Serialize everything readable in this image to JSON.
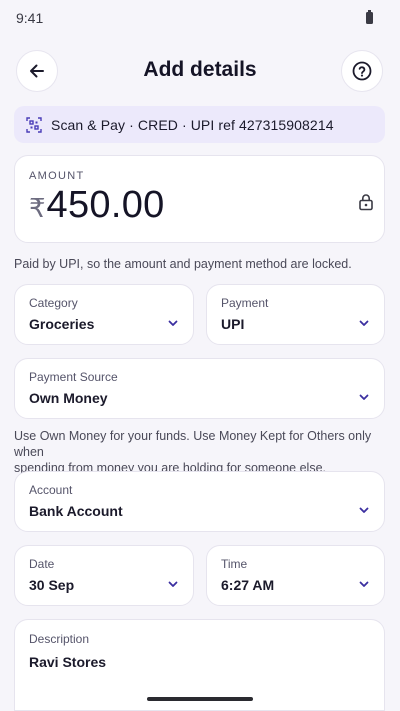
{
  "status_bar": {
    "time": "9:41"
  },
  "header": {
    "title": "Add details"
  },
  "banner": {
    "text": "Scan & Pay · CRED · UPI ref 427315908214"
  },
  "amount": {
    "label": "AMOUNT",
    "currency": "₹",
    "value": "450.00"
  },
  "locked_note": "Paid by UPI, so the amount and payment method are locked.",
  "category": {
    "label": "Category",
    "value": "Groceries"
  },
  "payment": {
    "label": "Payment",
    "value": "UPI"
  },
  "payment_source": {
    "label": "Payment Source",
    "value": "Own Money"
  },
  "source_note": {
    "line1": "Use Own Money for your funds. Use Money Kept for Others only when",
    "line2": "spending from money you are holding for someone else."
  },
  "account": {
    "label": "Account",
    "value": "Bank Account"
  },
  "date": {
    "label": "Date",
    "value": "30 Sep"
  },
  "time": {
    "label": "Time",
    "value": "6:27 AM"
  },
  "description": {
    "label": "Description",
    "value": "Ravi Stores"
  },
  "colors": {
    "accent": "#3b2fa0",
    "banner_bg": "#ece9fb",
    "page_bg": "#f6f5fa"
  }
}
